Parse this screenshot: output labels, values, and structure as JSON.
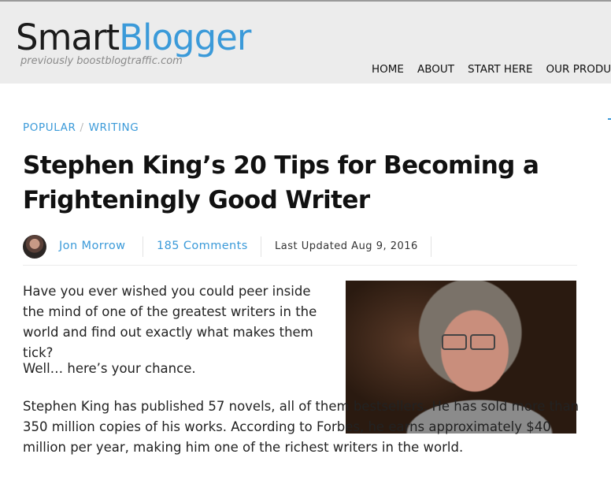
{
  "header": {
    "logo_part1": "Smart",
    "logo_part2": "Blogger",
    "tagline": "previously boostblogtraffic.com",
    "nav": [
      "HOME",
      "ABOUT",
      "START HERE",
      "OUR PRODUCTS"
    ]
  },
  "breadcrumb": {
    "items": [
      "POPULAR",
      "WRITING"
    ],
    "separator": "/"
  },
  "article": {
    "title": "Stephen King’s 20 Tips for Becoming a Frighteningly Good Writer",
    "author": "Jon Morrow",
    "comments": "185 Comments",
    "updated": "Last Updated Aug 9, 2016",
    "paragraphs": [
      "Have you ever wished you could peer inside the mind of one of the greatest writers in the world and find out exactly what makes them tick?",
      "Well… here’s your chance.",
      "Stephen King has published 57 novels, all of them bestsellers. He has sold more than 350 million copies of his works. According to Forbes, he earns approximately $40 million per year, making him one of the richest writers in the world."
    ]
  },
  "colors": {
    "accent": "#3b9ad9",
    "header_bg": "#ececec",
    "text": "#222222"
  },
  "icons": {
    "author_avatar": "avatar-photo",
    "article_photo": "stephen-king-photo"
  }
}
